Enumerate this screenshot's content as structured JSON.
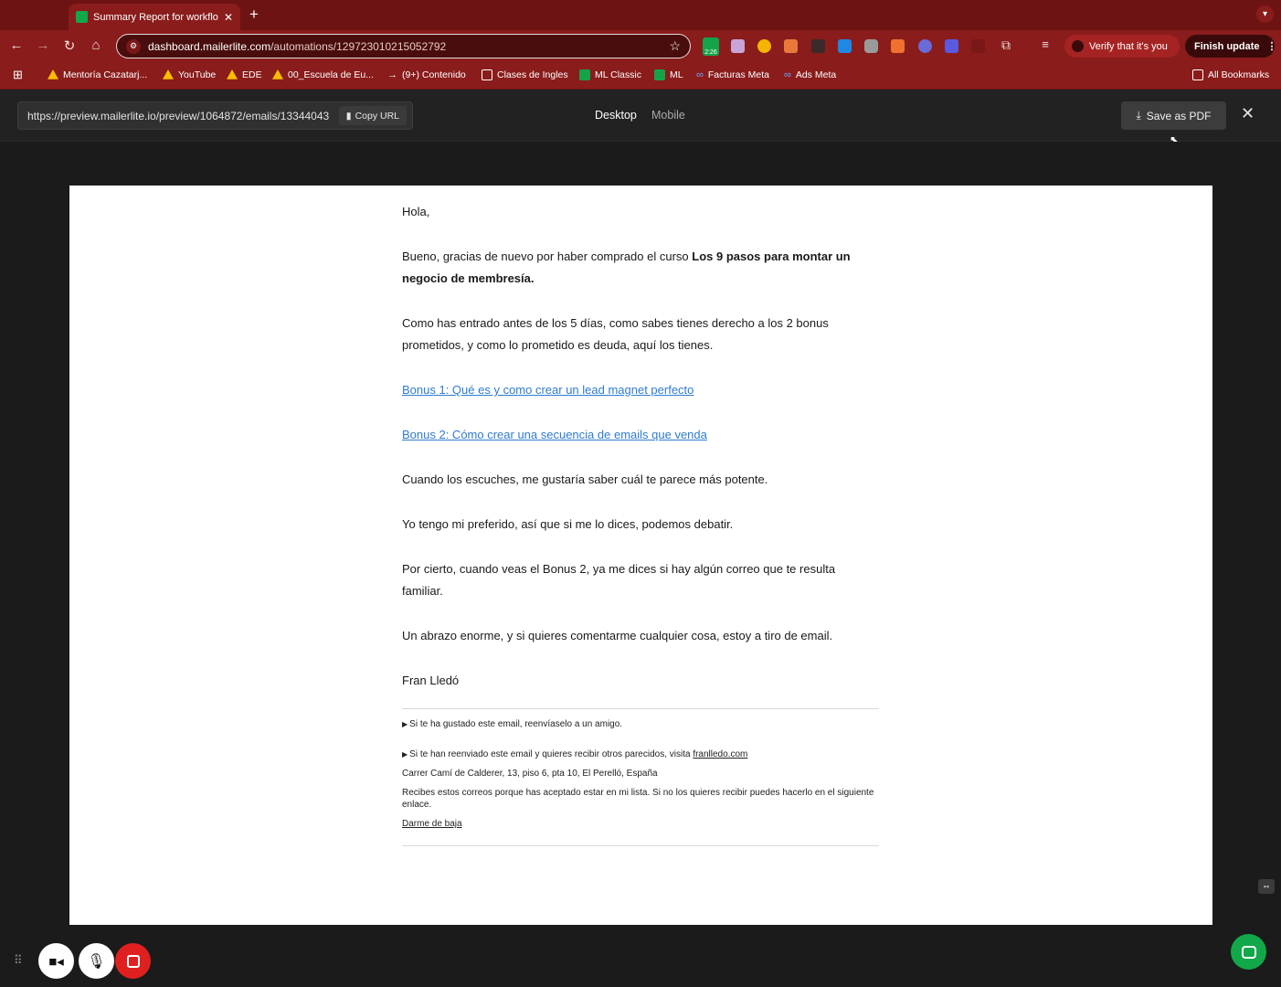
{
  "browser": {
    "tab_title": "Summary Report for workflow",
    "new_tab": "+",
    "url_host": "dashboard.mailerlite.com",
    "url_path": "/automations/129723010215052792",
    "ext_badge": "2:26",
    "verify_label": "Verify that it's you",
    "finish_update_label": "Finish update",
    "bookmarks": [
      {
        "label": "Mentoría Cazatarj..."
      },
      {
        "label": "YouTube"
      },
      {
        "label": "EDE"
      },
      {
        "label": "00_Escuela de Eu..."
      },
      {
        "label": "(9+) Contenido"
      },
      {
        "label": "Clases de Ingles"
      },
      {
        "label": "ML Classic"
      },
      {
        "label": "ML"
      },
      {
        "label": "Facturas Meta"
      },
      {
        "label": "Ads Meta"
      }
    ],
    "all_bookmarks": "All Bookmarks"
  },
  "preview_header": {
    "url": "https://preview.mailerlite.io/preview/1064872/emails/13344043",
    "copy_url": "Copy URL",
    "tab_desktop": "Desktop",
    "tab_mobile": "Mobile",
    "save_pdf": "Save as PDF"
  },
  "email": {
    "greeting": "Hola,",
    "p1_start": "Bueno, gracias de nuevo por haber comprado el curso ",
    "p1_bold": "Los 9 pasos para montar un negocio de membresía.",
    "p2": "Como has entrado antes de los 5 días, como sabes tienes derecho a los 2 bonus prometidos, y como lo prometido es deuda, aquí los tienes.",
    "bonus1": "Bonus 1: Qué es y como crear un lead magnet perfecto",
    "bonus2": "Bonus 2: Cómo crear una secuencia de emails que venda",
    "p3": "Cuando los escuches, me gustaría saber cuál te parece más potente.",
    "p4": "Yo tengo mi preferido, así que si me lo dices, podemos debatir.",
    "p5": "Por cierto, cuando veas el Bonus 2, ya me dices si hay algún correo que te resulta familiar.",
    "p6": "Un abrazo enorme, y si quieres comentarme cualquier cosa, estoy a tiro de email.",
    "signature": "Fran Lledó",
    "footer_forward": "Si te ha gustado este email, reenvíaselo a un amigo.",
    "footer_forwarded": "Si te han reenviado este email y quieres recibir otros parecidos, visita ",
    "footer_site": "franlledo.com",
    "footer_address": "Carrer Camí de Calderer, 13, piso 6, pta 10, El Perelló, España",
    "footer_reason": "Recibes estos correos porque has aceptado estar en mi lista. Si no los quieres recibir puedes hacerlo en el siguiente enlace.",
    "unsubscribe": "Darme de baja"
  },
  "colors": {
    "chrome_dark": "#6e1313",
    "chrome": "#8a1c1c",
    "link": "#2e7bcf",
    "chat_green": "#11a84a",
    "record_red": "#e02020"
  }
}
